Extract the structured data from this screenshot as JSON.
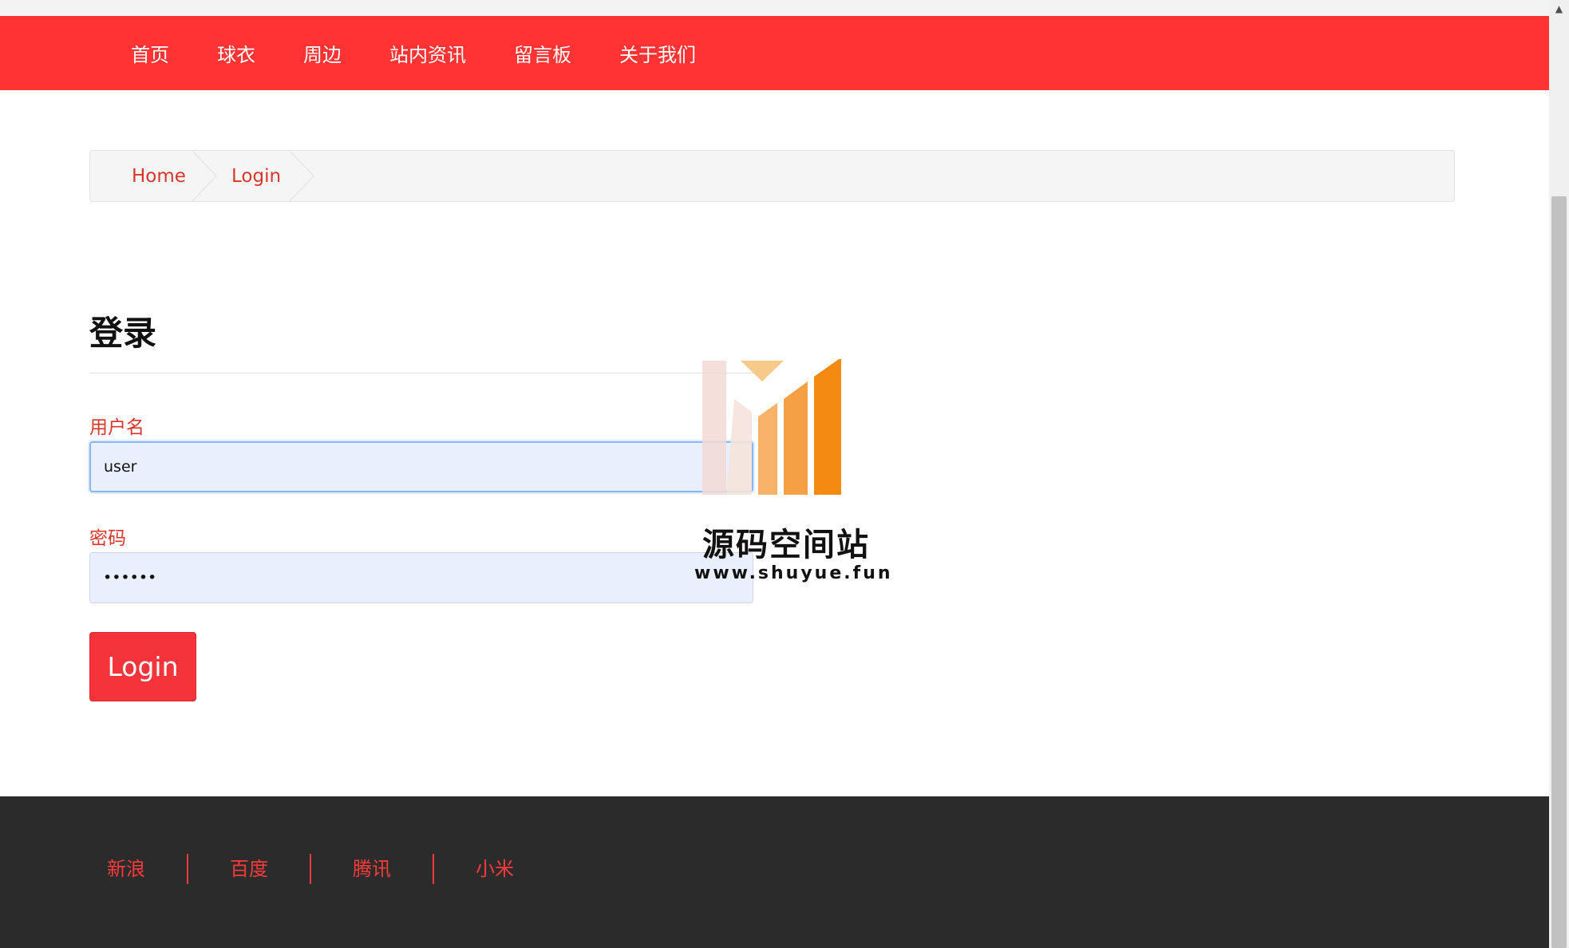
{
  "navbar": {
    "items": [
      {
        "label": "首页"
      },
      {
        "label": "球衣"
      },
      {
        "label": "周边"
      },
      {
        "label": "站内资讯"
      },
      {
        "label": "留言板"
      },
      {
        "label": "关于我们"
      }
    ],
    "color": "#ff3333"
  },
  "breadcrumb": {
    "items": [
      {
        "label": "Home"
      },
      {
        "label": "Login"
      }
    ]
  },
  "login": {
    "title": "登录",
    "username_label": "用户名",
    "username_value": "user",
    "password_label": "密码",
    "password_value": "••••••",
    "button_label": "Login"
  },
  "watermark": {
    "name": "源码空间站",
    "url": "www.shuyue.fun"
  },
  "footer": {
    "links": [
      {
        "label": "新浪"
      },
      {
        "label": "百度"
      },
      {
        "label": "腾讯"
      },
      {
        "label": "小米"
      }
    ]
  },
  "colors": {
    "brand_red": "#ff3333",
    "link_red": "#d9352b",
    "footer_bg": "#2b2b2b",
    "input_bg": "#e8f0fe"
  }
}
